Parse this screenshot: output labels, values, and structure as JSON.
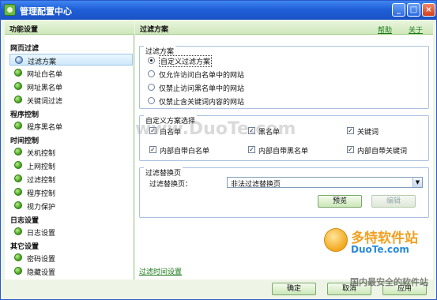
{
  "window": {
    "title": "管理配置中心",
    "min": "_",
    "max": "□",
    "close": "×"
  },
  "sidebar": {
    "header": "功能设置",
    "groups": [
      {
        "title": "网页过滤",
        "items": [
          "过滤方案",
          "网址白名单",
          "网址黑名单",
          "关键词过滤"
        ]
      },
      {
        "title": "程序控制",
        "items": [
          "程序黑名单"
        ]
      },
      {
        "title": "时间控制",
        "items": [
          "关机控制",
          "上网控制",
          "过滤控制",
          "程序控制",
          "视力保护"
        ]
      },
      {
        "title": "日志设置",
        "items": [
          "日志设置"
        ]
      },
      {
        "title": "其它设置",
        "items": [
          "密码设置",
          "隐藏设置"
        ]
      }
    ],
    "selected": "过滤方案"
  },
  "content": {
    "header": "过滤方案",
    "help": "帮助",
    "about": "关于",
    "scheme_box": {
      "legend": "过滤方案",
      "options": [
        "自定义过滤方案",
        "仅允许访问白名单中的网站",
        "仅禁止访问黑名单中的网站",
        "仅禁止含关键词内容的网站"
      ],
      "selected_index": 0
    },
    "custom_box": {
      "legend": "自定义方案选择",
      "checks": [
        "白名单",
        "黑名单",
        "关键词",
        "内部自带白名单",
        "内部自带黑名单",
        "内部自带关键词"
      ]
    },
    "replace_box": {
      "legend": "过滤替换页",
      "label": "过滤替换页：",
      "select_value": "非法过滤替换页",
      "preview": "预览",
      "edit": "编辑"
    },
    "footer_link": "过滤时间设置"
  },
  "buttons": {
    "ok": "确定",
    "cancel": "取消",
    "apply": "应用"
  },
  "watermarks": {
    "center": "www.DuoTe.com",
    "brand": "多特软件站",
    "brand_url": "DuoTe.com",
    "slogan": "国内最安全的软件站"
  }
}
